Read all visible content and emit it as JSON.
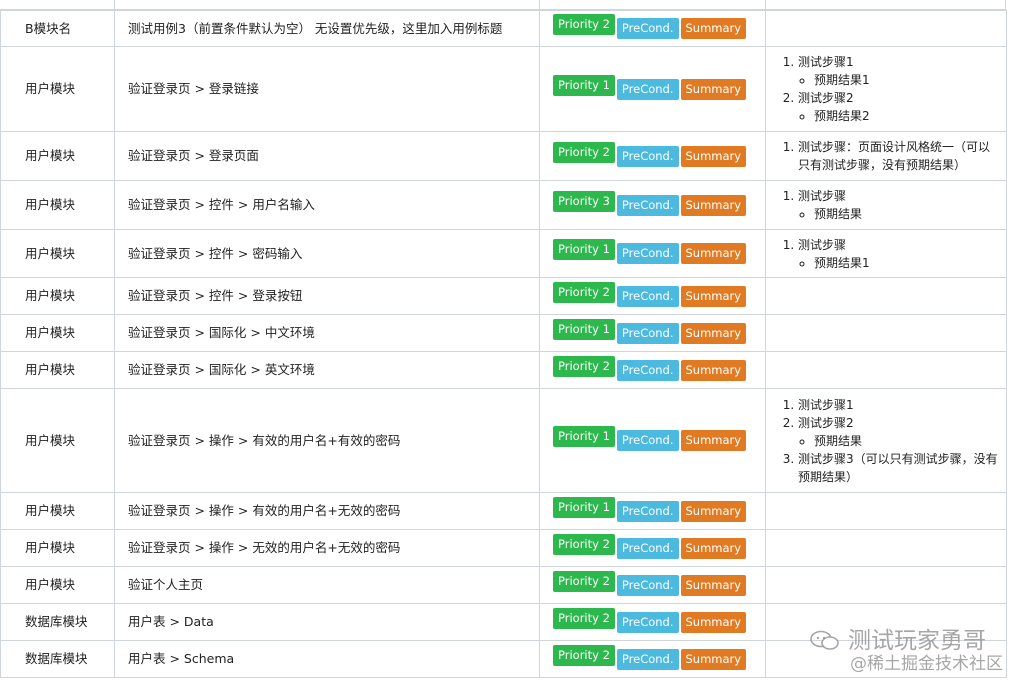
{
  "rows": [
    {
      "module": "B模块名",
      "title": "测试用例3（前置条件默认为空） 无设置优先级，这里加入用例标题",
      "priority": "Priority 2",
      "precond": "PreCond.",
      "summary": "Summary",
      "steps": []
    },
    {
      "module": "用户模块",
      "title": "验证登录页 > 登录链接",
      "priority": "Priority 1",
      "precond": "PreCond.",
      "summary": "Summary",
      "steps": [
        {
          "text": "测试步骤1",
          "results": [
            "预期结果1"
          ]
        },
        {
          "text": "测试步骤2",
          "results": [
            "预期结果2"
          ]
        }
      ]
    },
    {
      "module": "用户模块",
      "title": "验证登录页 > 登录页面",
      "priority": "Priority 2",
      "precond": "PreCond.",
      "summary": "Summary",
      "steps": [
        {
          "text": "测试步骤：页面设计风格统一（可以只有测试步骤，没有预期结果）",
          "results": []
        }
      ]
    },
    {
      "module": "用户模块",
      "title": "验证登录页 > 控件 > 用户名输入",
      "priority": "Priority 3",
      "precond": "PreCond.",
      "summary": "Summary",
      "steps": [
        {
          "text": "测试步骤",
          "results": [
            "预期结果"
          ]
        }
      ]
    },
    {
      "module": "用户模块",
      "title": "验证登录页 > 控件 > 密码输入",
      "priority": "Priority 1",
      "precond": "PreCond.",
      "summary": "Summary",
      "steps": [
        {
          "text": "测试步骤",
          "results": [
            "预期结果1"
          ]
        }
      ]
    },
    {
      "module": "用户模块",
      "title": "验证登录页 > 控件 > 登录按钮",
      "priority": "Priority 2",
      "precond": "PreCond.",
      "summary": "Summary",
      "steps": []
    },
    {
      "module": "用户模块",
      "title": "验证登录页 > 国际化 > 中文环境",
      "priority": "Priority 1",
      "precond": "PreCond.",
      "summary": "Summary",
      "steps": []
    },
    {
      "module": "用户模块",
      "title": "验证登录页 > 国际化 > 英文环境",
      "priority": "Priority 2",
      "precond": "PreCond.",
      "summary": "Summary",
      "steps": []
    },
    {
      "module": "用户模块",
      "title": "验证登录页 > 操作 > 有效的用户名+有效的密码",
      "priority": "Priority 1",
      "precond": "PreCond.",
      "summary": "Summary",
      "steps": [
        {
          "text": "测试步骤1",
          "results": []
        },
        {
          "text": "测试步骤2",
          "results": [
            "预期结果"
          ]
        },
        {
          "text": "测试步骤3（可以只有测试步骤，没有预期结果）",
          "results": []
        }
      ]
    },
    {
      "module": "用户模块",
      "title": "验证登录页 > 操作 > 有效的用户名+无效的密码",
      "priority": "Priority 1",
      "precond": "PreCond.",
      "summary": "Summary",
      "steps": []
    },
    {
      "module": "用户模块",
      "title": "验证登录页 > 操作 > 无效的用户名+无效的密码",
      "priority": "Priority 2",
      "precond": "PreCond.",
      "summary": "Summary",
      "steps": []
    },
    {
      "module": "用户模块",
      "title": "验证个人主页",
      "priority": "Priority 2",
      "precond": "PreCond.",
      "summary": "Summary",
      "steps": []
    },
    {
      "module": "数据库模块",
      "title": "用户表 > Data",
      "priority": "Priority 2",
      "precond": "PreCond.",
      "summary": "Summary",
      "steps": []
    },
    {
      "module": "数据库模块",
      "title": "用户表 > Schema",
      "priority": "Priority 2",
      "precond": "PreCond.",
      "summary": "Summary",
      "steps": []
    }
  ],
  "watermark": {
    "line1": "测试玩家勇哥",
    "line2": "@稀土掘金技术社区",
    "icon": "wechat-icon"
  },
  "colors": {
    "priority": "#2db84d",
    "precond": "#4cb9df",
    "summary": "#e07b24",
    "border": "#cfd5da"
  }
}
